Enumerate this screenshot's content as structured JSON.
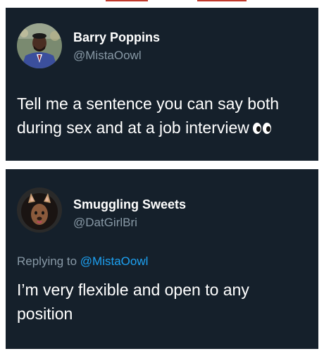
{
  "tweets": [
    {
      "author_name": "Barry Poppins",
      "author_handle": "@MistaOowl",
      "text": "Tell me a sentence you can say both during sex and at a job interview",
      "emoji": "eyes-emoji"
    },
    {
      "author_name": "Smuggling Sweets",
      "author_handle": "@DatGirlBri",
      "replying_label": "Replying to",
      "replying_to": "@MistaOowl",
      "text": "I’m very flexible and open to any position"
    }
  ],
  "colors": {
    "card_bg": "#15202b",
    "secondary_text": "#8899a6",
    "mention": "#1da1f2",
    "top_accent": "#c0392b"
  }
}
